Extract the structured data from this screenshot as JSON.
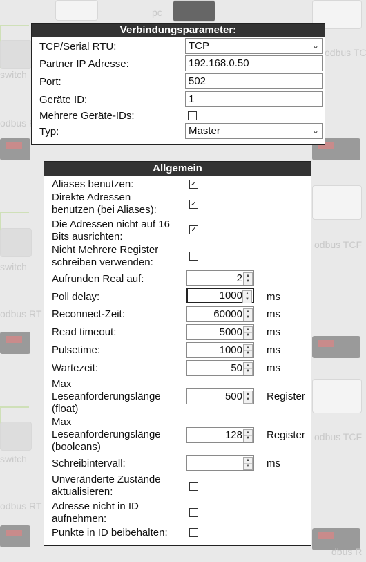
{
  "background": {
    "texts": [
      "pc",
      "switch",
      "switch",
      "switch",
      "odbus TCF",
      "odbus TCF",
      "odbus TCF",
      "odbus RT",
      "odbus RT",
      "odbus RT",
      "dbus R"
    ]
  },
  "verbindung": {
    "title": "Verbindungsparameter:",
    "rows": [
      {
        "label": "TCP/Serial RTU:",
        "type": "select",
        "value": "TCP"
      },
      {
        "label": "Partner IP Adresse:",
        "type": "text",
        "value": "192.168.0.50"
      },
      {
        "label": "Port:",
        "type": "text",
        "value": "502"
      },
      {
        "label": "Geräte ID:",
        "type": "text",
        "value": "1"
      },
      {
        "label": "Mehrere Geräte-IDs:",
        "type": "checkbox",
        "checked": false
      },
      {
        "label": "Typ:",
        "type": "select",
        "value": "Master"
      }
    ]
  },
  "allgemein": {
    "title": "Allgemein",
    "rows": [
      {
        "label": "Aliases benutzen:",
        "type": "checkbox",
        "checked": true,
        "mark": "✓"
      },
      {
        "label": "Direkte Adressen benutzen (bei Aliases):",
        "type": "checkbox",
        "checked": true,
        "mark": "✓"
      },
      {
        "label": "Die Adressen nicht auf 16 Bits ausrichten:",
        "type": "checkbox",
        "checked": true,
        "mark": "✓"
      },
      {
        "label": "Nicht Mehrere Register schreiben verwenden:",
        "type": "checkbox",
        "checked": false,
        "mark": ""
      },
      {
        "label": "Aufrunden Real auf:",
        "type": "number",
        "value": "2",
        "unit": ""
      },
      {
        "label": "Poll delay:",
        "type": "number",
        "value": "1000",
        "unit": "ms",
        "focus": true
      },
      {
        "label": "Reconnect-Zeit:",
        "type": "number",
        "value": "60000",
        "unit": "ms"
      },
      {
        "label": "Read timeout:",
        "type": "number",
        "value": "5000",
        "unit": "ms"
      },
      {
        "label": "Pulsetime:",
        "type": "number",
        "value": "1000",
        "unit": "ms"
      },
      {
        "label": "Wartezeit:",
        "type": "number",
        "value": "50",
        "unit": "ms"
      },
      {
        "label": "Max Leseanforderungslänge (float)",
        "type": "number",
        "value": "500",
        "unit": "Register"
      },
      {
        "label": "Max Leseanforderungslänge (booleans)",
        "type": "number",
        "value": "128",
        "unit": "Register"
      },
      {
        "label": "Schreibintervall:",
        "type": "number",
        "value": "",
        "unit": "ms"
      },
      {
        "label": "Unveränderte Zustände aktualisieren:",
        "type": "checkbox",
        "checked": false,
        "mark": ""
      },
      {
        "label": "Adresse nicht in ID aufnehmen:",
        "type": "checkbox",
        "checked": false,
        "mark": ""
      },
      {
        "label": "Punkte in ID beibehalten:",
        "type": "checkbox",
        "checked": false,
        "mark": ""
      }
    ]
  }
}
